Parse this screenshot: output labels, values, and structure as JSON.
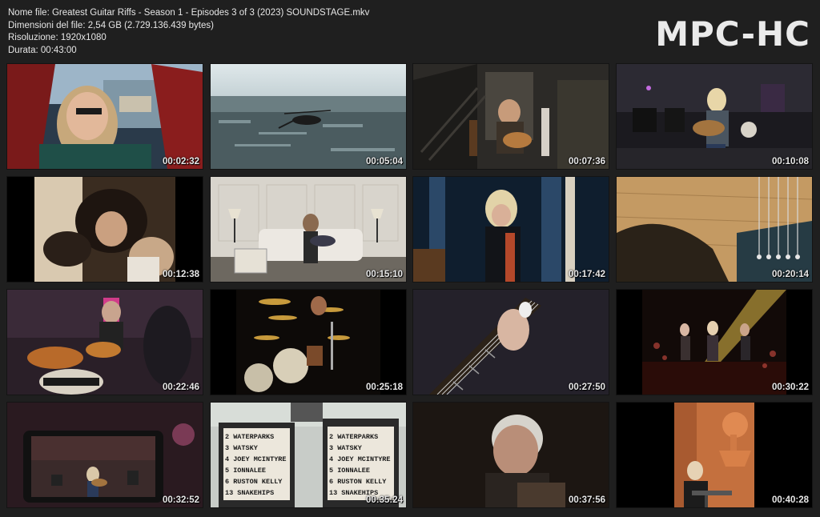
{
  "info": {
    "file_name": "Nome file: Greatest Guitar Riffs - Season 1 - Episodes 3 of 3 (2023) SOUNDSTAGE.mkv",
    "file_size": "Dimensioni del file: 2,54 GB (2.729.136.439 bytes)",
    "resolution": "Risoluzione: 1920x1080",
    "duration": "Durata: 00:43:00"
  },
  "logo": "MPC-HC",
  "thumbnails": [
    {
      "time": "00:02:32",
      "scene": "car-driver"
    },
    {
      "time": "00:05:04",
      "scene": "helicopter-over-city"
    },
    {
      "time": "00:07:36",
      "scene": "guitarist-stairs"
    },
    {
      "time": "00:10:08",
      "scene": "guitarist-studio"
    },
    {
      "time": "00:12:38",
      "scene": "crowd-close"
    },
    {
      "time": "00:15:10",
      "scene": "woman-sofa-guitar"
    },
    {
      "time": "00:17:42",
      "scene": "guitarist-blue"
    },
    {
      "time": "00:20:14",
      "scene": "guitar-bridge-closeup"
    },
    {
      "time": "00:22:46",
      "scene": "drummer-yamaha"
    },
    {
      "time": "00:25:18",
      "scene": "drum-kit-stage"
    },
    {
      "time": "00:27:50",
      "scene": "guitar-neck-hand"
    },
    {
      "time": "00:30:22",
      "scene": "concert-stage"
    },
    {
      "time": "00:32:52",
      "scene": "camera-monitor"
    },
    {
      "time": "00:35:24",
      "scene": "marquee-sign"
    },
    {
      "time": "00:37:56",
      "scene": "man-portrait"
    },
    {
      "time": "00:40:28",
      "scene": "award-podium"
    }
  ],
  "marquee": {
    "lines": [
      "2 WATERPARKS",
      "3 WATSKY",
      "4 JOEY MCINTYRE",
      "5 IONNALEE",
      "6 RUSTON KELLY",
      "13 SNAKEHIPS"
    ]
  }
}
